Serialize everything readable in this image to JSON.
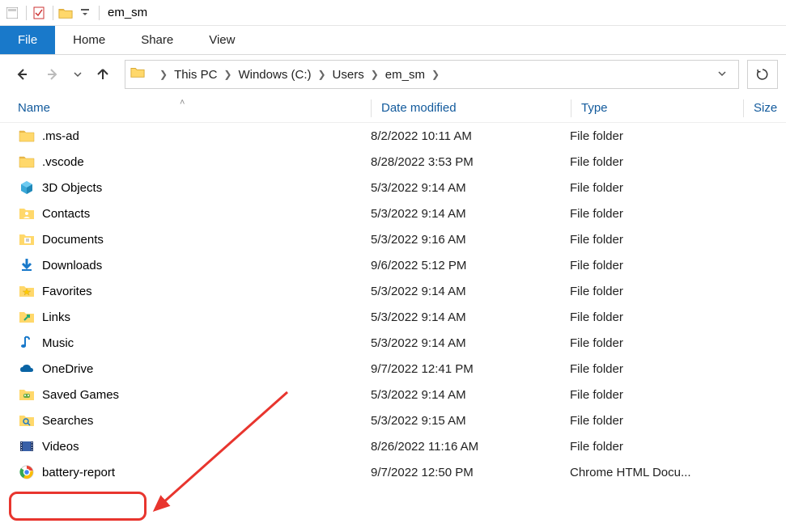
{
  "title": {
    "folder": "em_sm"
  },
  "ribbon": {
    "file": "File",
    "tabs": [
      "Home",
      "Share",
      "View"
    ]
  },
  "breadcrumb": [
    "This PC",
    "Windows (C:)",
    "Users",
    "em_sm"
  ],
  "headers": {
    "name": "Name",
    "date": "Date modified",
    "type": "Type",
    "size": "Size"
  },
  "items": [
    {
      "icon": "folder",
      "name": ".ms-ad",
      "date": "8/2/2022 10:11 AM",
      "type": "File folder"
    },
    {
      "icon": "folder",
      "name": ".vscode",
      "date": "8/28/2022 3:53 PM",
      "type": "File folder"
    },
    {
      "icon": "3d",
      "name": "3D Objects",
      "date": "5/3/2022 9:14 AM",
      "type": "File folder"
    },
    {
      "icon": "contacts",
      "name": "Contacts",
      "date": "5/3/2022 9:14 AM",
      "type": "File folder"
    },
    {
      "icon": "documents",
      "name": "Documents",
      "date": "5/3/2022 9:16 AM",
      "type": "File folder"
    },
    {
      "icon": "downloads",
      "name": "Downloads",
      "date": "9/6/2022 5:12 PM",
      "type": "File folder"
    },
    {
      "icon": "favorites",
      "name": "Favorites",
      "date": "5/3/2022 9:14 AM",
      "type": "File folder"
    },
    {
      "icon": "links",
      "name": "Links",
      "date": "5/3/2022 9:14 AM",
      "type": "File folder"
    },
    {
      "icon": "music",
      "name": "Music",
      "date": "5/3/2022 9:14 AM",
      "type": "File folder"
    },
    {
      "icon": "onedrive",
      "name": "OneDrive",
      "date": "9/7/2022 12:41 PM",
      "type": "File folder"
    },
    {
      "icon": "savedgames",
      "name": "Saved Games",
      "date": "5/3/2022 9:14 AM",
      "type": "File folder"
    },
    {
      "icon": "searches",
      "name": "Searches",
      "date": "5/3/2022 9:15 AM",
      "type": "File folder"
    },
    {
      "icon": "videos",
      "name": "Videos",
      "date": "8/26/2022 11:16 AM",
      "type": "File folder"
    },
    {
      "icon": "chrome",
      "name": "battery-report",
      "date": "9/7/2022 12:50 PM",
      "type": "Chrome HTML Docu..."
    }
  ]
}
